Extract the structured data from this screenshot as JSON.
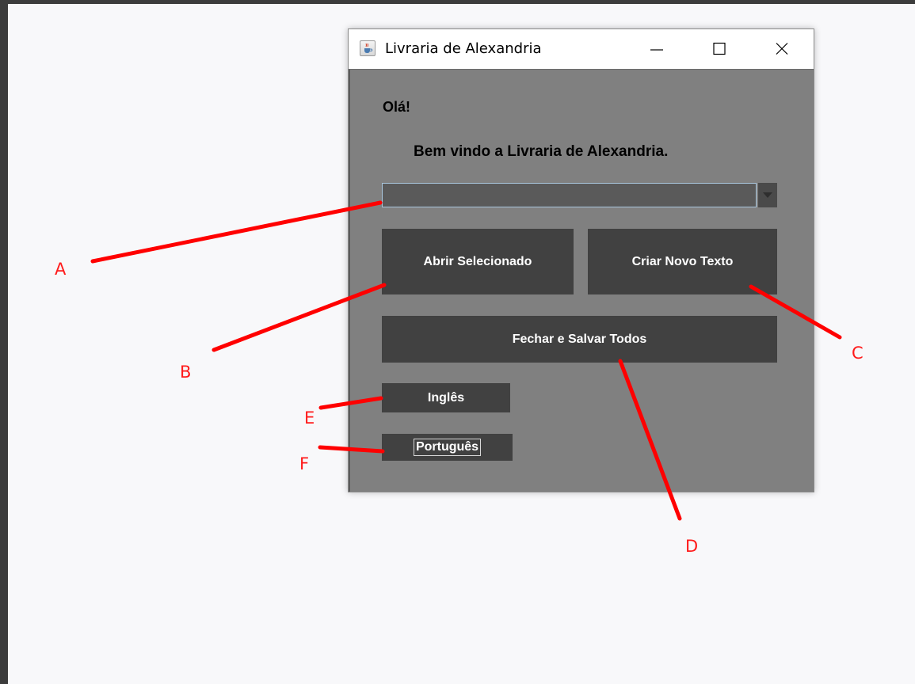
{
  "window": {
    "title": "Livraria de Alexandria",
    "icon": "java-cup-icon",
    "controls": [
      "minimize-icon",
      "maximize-icon",
      "close-icon"
    ]
  },
  "content": {
    "greeting": "Olá!",
    "welcome": "Bem vindo a Livraria de Alexandria.",
    "combo": {
      "selected_value": ""
    },
    "buttons": {
      "open_selected": "Abrir Selecionado",
      "create_new_text": "Criar Novo Texto",
      "close_and_save_all": "Fechar e Salvar Todos",
      "english": "Inglês",
      "portuguese": "Português"
    }
  },
  "annotation_labels": {
    "a": "A",
    "b": "B",
    "c": "C",
    "d": "D",
    "e": "E",
    "f": "F"
  },
  "colors": {
    "panel_background": "#808080",
    "button_background": "#414141",
    "button_text": "#ffffff",
    "annotation": "#ff0000"
  }
}
